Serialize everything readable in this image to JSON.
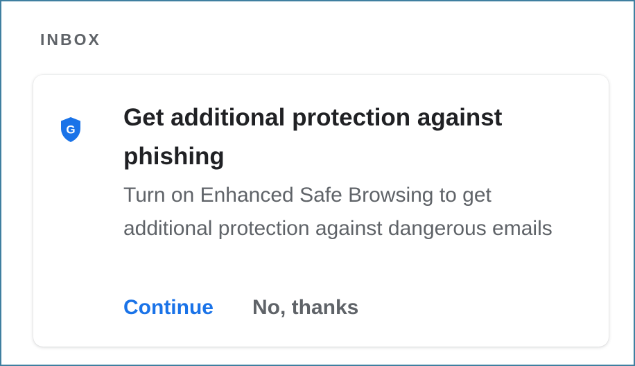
{
  "section": {
    "label": "INBOX"
  },
  "promo_card": {
    "icon": "google-shield-icon",
    "icon_letter": "G",
    "title": "Get additional protection against phishing",
    "body": "Turn on Enhanced Safe Browsing to get additional protection against dangerous emails",
    "actions": {
      "primary_label": "Continue",
      "secondary_label": "No, thanks"
    }
  },
  "colors": {
    "frame_border": "#3f7fa0",
    "shield": "#1a73e8",
    "primary_action": "#1a73e8",
    "title_text": "#202124",
    "secondary_text": "#5f6368"
  }
}
